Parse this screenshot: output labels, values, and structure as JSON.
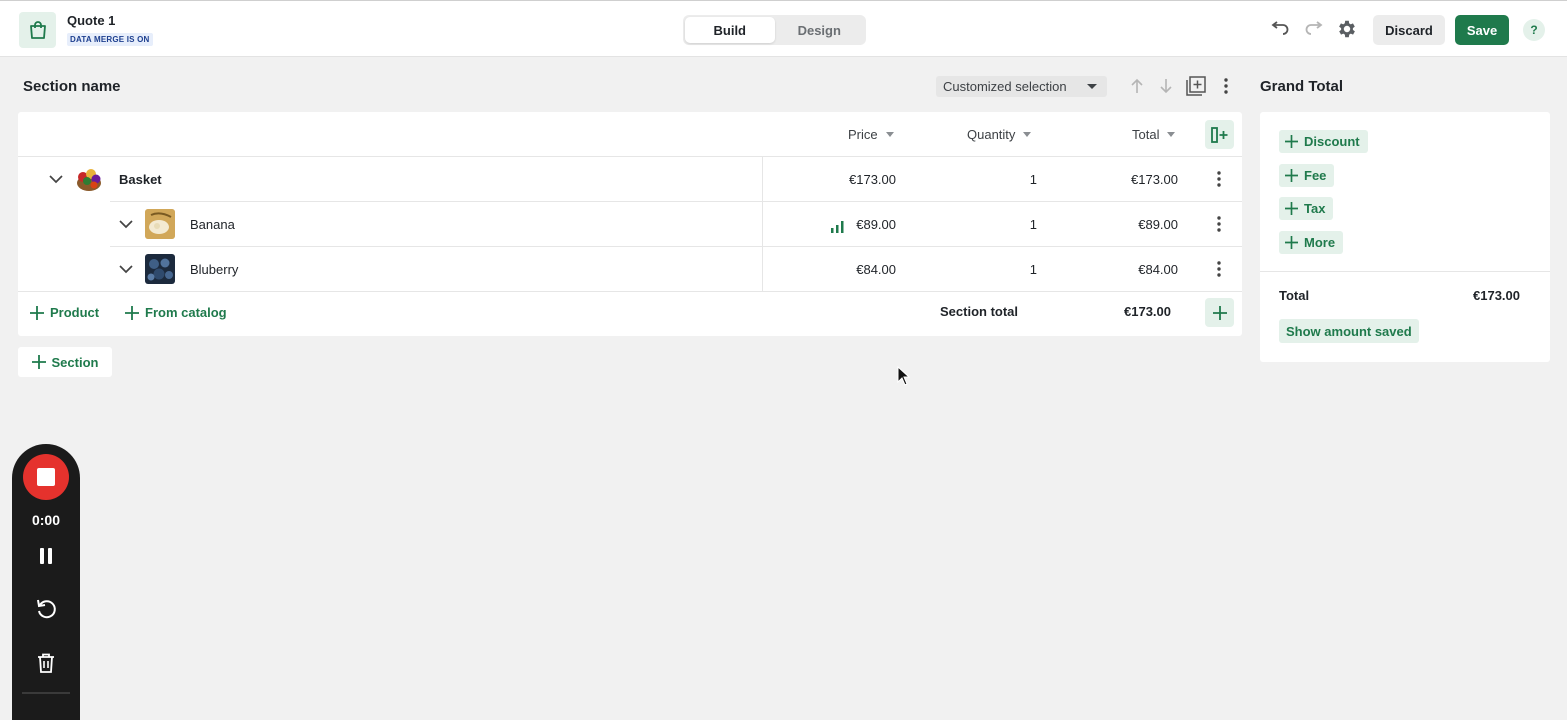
{
  "app": {
    "title": "Quote 1",
    "merge_badge": "DATA MERGE IS ON",
    "accent": "#1f7a4c",
    "accent_light": "#e4f1ea"
  },
  "tabs": {
    "build": "Build",
    "design": "Design"
  },
  "toolbar": {
    "undo_icon": "undo-icon",
    "redo_icon": "redo-icon",
    "settings_icon": "gear-icon",
    "discard_label": "Discard",
    "save_label": "Save",
    "help_label": "?"
  },
  "section": {
    "name": "Section name",
    "selection_label": "Customized selection",
    "columns": {
      "price": "Price",
      "quantity": "Quantity",
      "total": "Total"
    },
    "rows": [
      {
        "name": "Basket",
        "price": "€173.00",
        "quantity": "1",
        "total": "€173.00"
      },
      {
        "name": "Banana",
        "price": "€89.00",
        "quantity": "1",
        "total": "€89.00"
      },
      {
        "name": "Bluberry",
        "price": "€84.00",
        "quantity": "1",
        "total": "€84.00"
      }
    ],
    "add_product": "Product",
    "add_from_catalog": "From catalog",
    "section_total_label": "Section total",
    "section_total_value": "€173.00",
    "add_section": "Section"
  },
  "grand_total": {
    "title": "Grand Total",
    "chips": [
      "Discount",
      "Fee",
      "Tax",
      "More"
    ],
    "total_label": "Total",
    "total_value": "€173.00",
    "show_saved": "Show amount saved"
  },
  "recorder": {
    "time": "0:00"
  }
}
